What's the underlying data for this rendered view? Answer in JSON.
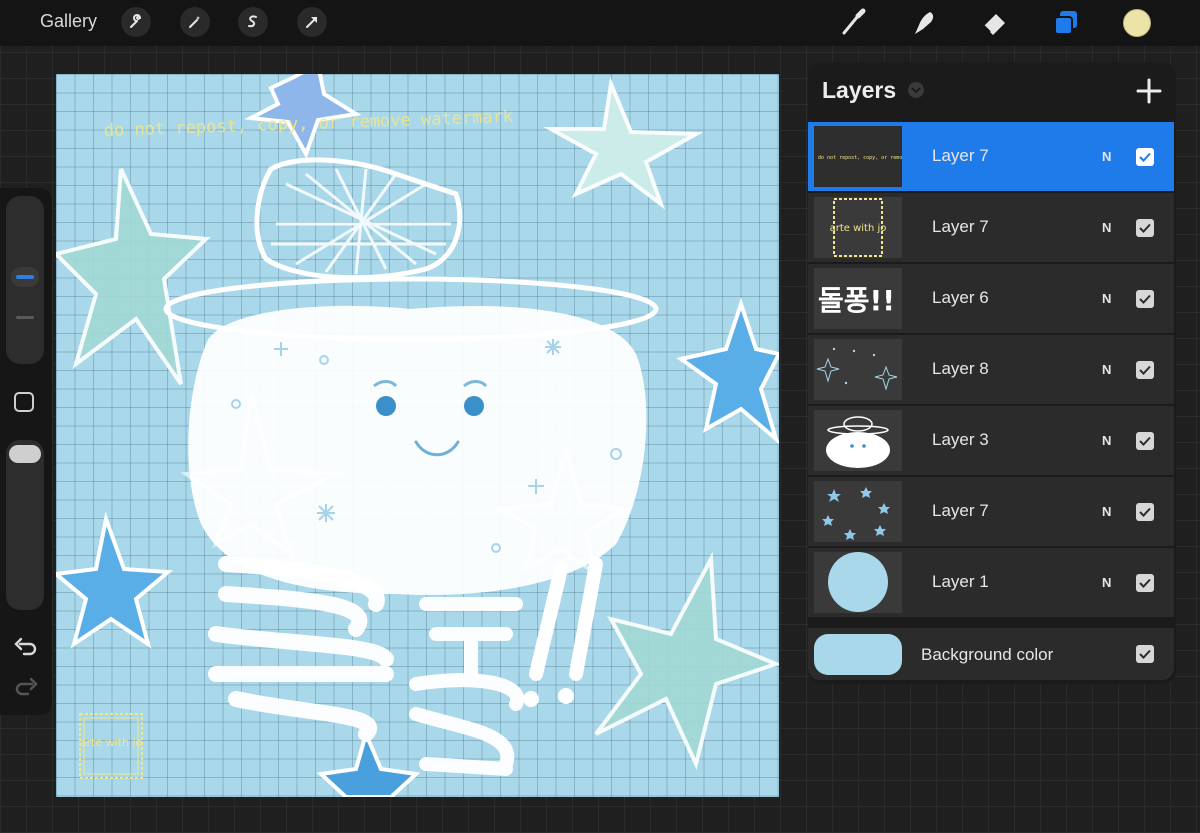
{
  "toolbar": {
    "gallery_label": "Gallery",
    "left_icons": [
      "wrench-icon",
      "magic-wand-icon",
      "selection-icon",
      "transform-arrow-icon"
    ],
    "right_icons": [
      "brush-icon",
      "smudge-icon",
      "eraser-icon",
      "layers-icon"
    ],
    "active_color": "#ece3a6"
  },
  "sidebar": {
    "brush_size_level": 0.55,
    "opacity_level": 1.0
  },
  "canvas": {
    "background_color": "#a9d8ea",
    "watermark_text": "do not repost, copy, or remove watermark",
    "logo_text": "arte with jo",
    "korean_text": "돌퐁!!"
  },
  "layers_panel": {
    "title": "Layers",
    "layers": [
      {
        "name": "Layer 7",
        "mode": "N",
        "visible": true,
        "selected": true,
        "thumb": "watermark"
      },
      {
        "name": "Layer 7",
        "mode": "N",
        "visible": true,
        "selected": false,
        "thumb": "logo"
      },
      {
        "name": "Layer 6",
        "mode": "N",
        "visible": true,
        "selected": false,
        "thumb": "text"
      },
      {
        "name": "Layer 8",
        "mode": "N",
        "visible": true,
        "selected": false,
        "thumb": "sparkles"
      },
      {
        "name": "Layer 3",
        "mode": "N",
        "visible": true,
        "selected": false,
        "thumb": "character"
      },
      {
        "name": "Layer 7",
        "mode": "N",
        "visible": true,
        "selected": false,
        "thumb": "stars"
      },
      {
        "name": "Layer 1",
        "mode": "N",
        "visible": true,
        "selected": false,
        "thumb": "circle"
      }
    ],
    "background": {
      "label": "Background color",
      "color": "#a9d8ea",
      "visible": true
    }
  }
}
